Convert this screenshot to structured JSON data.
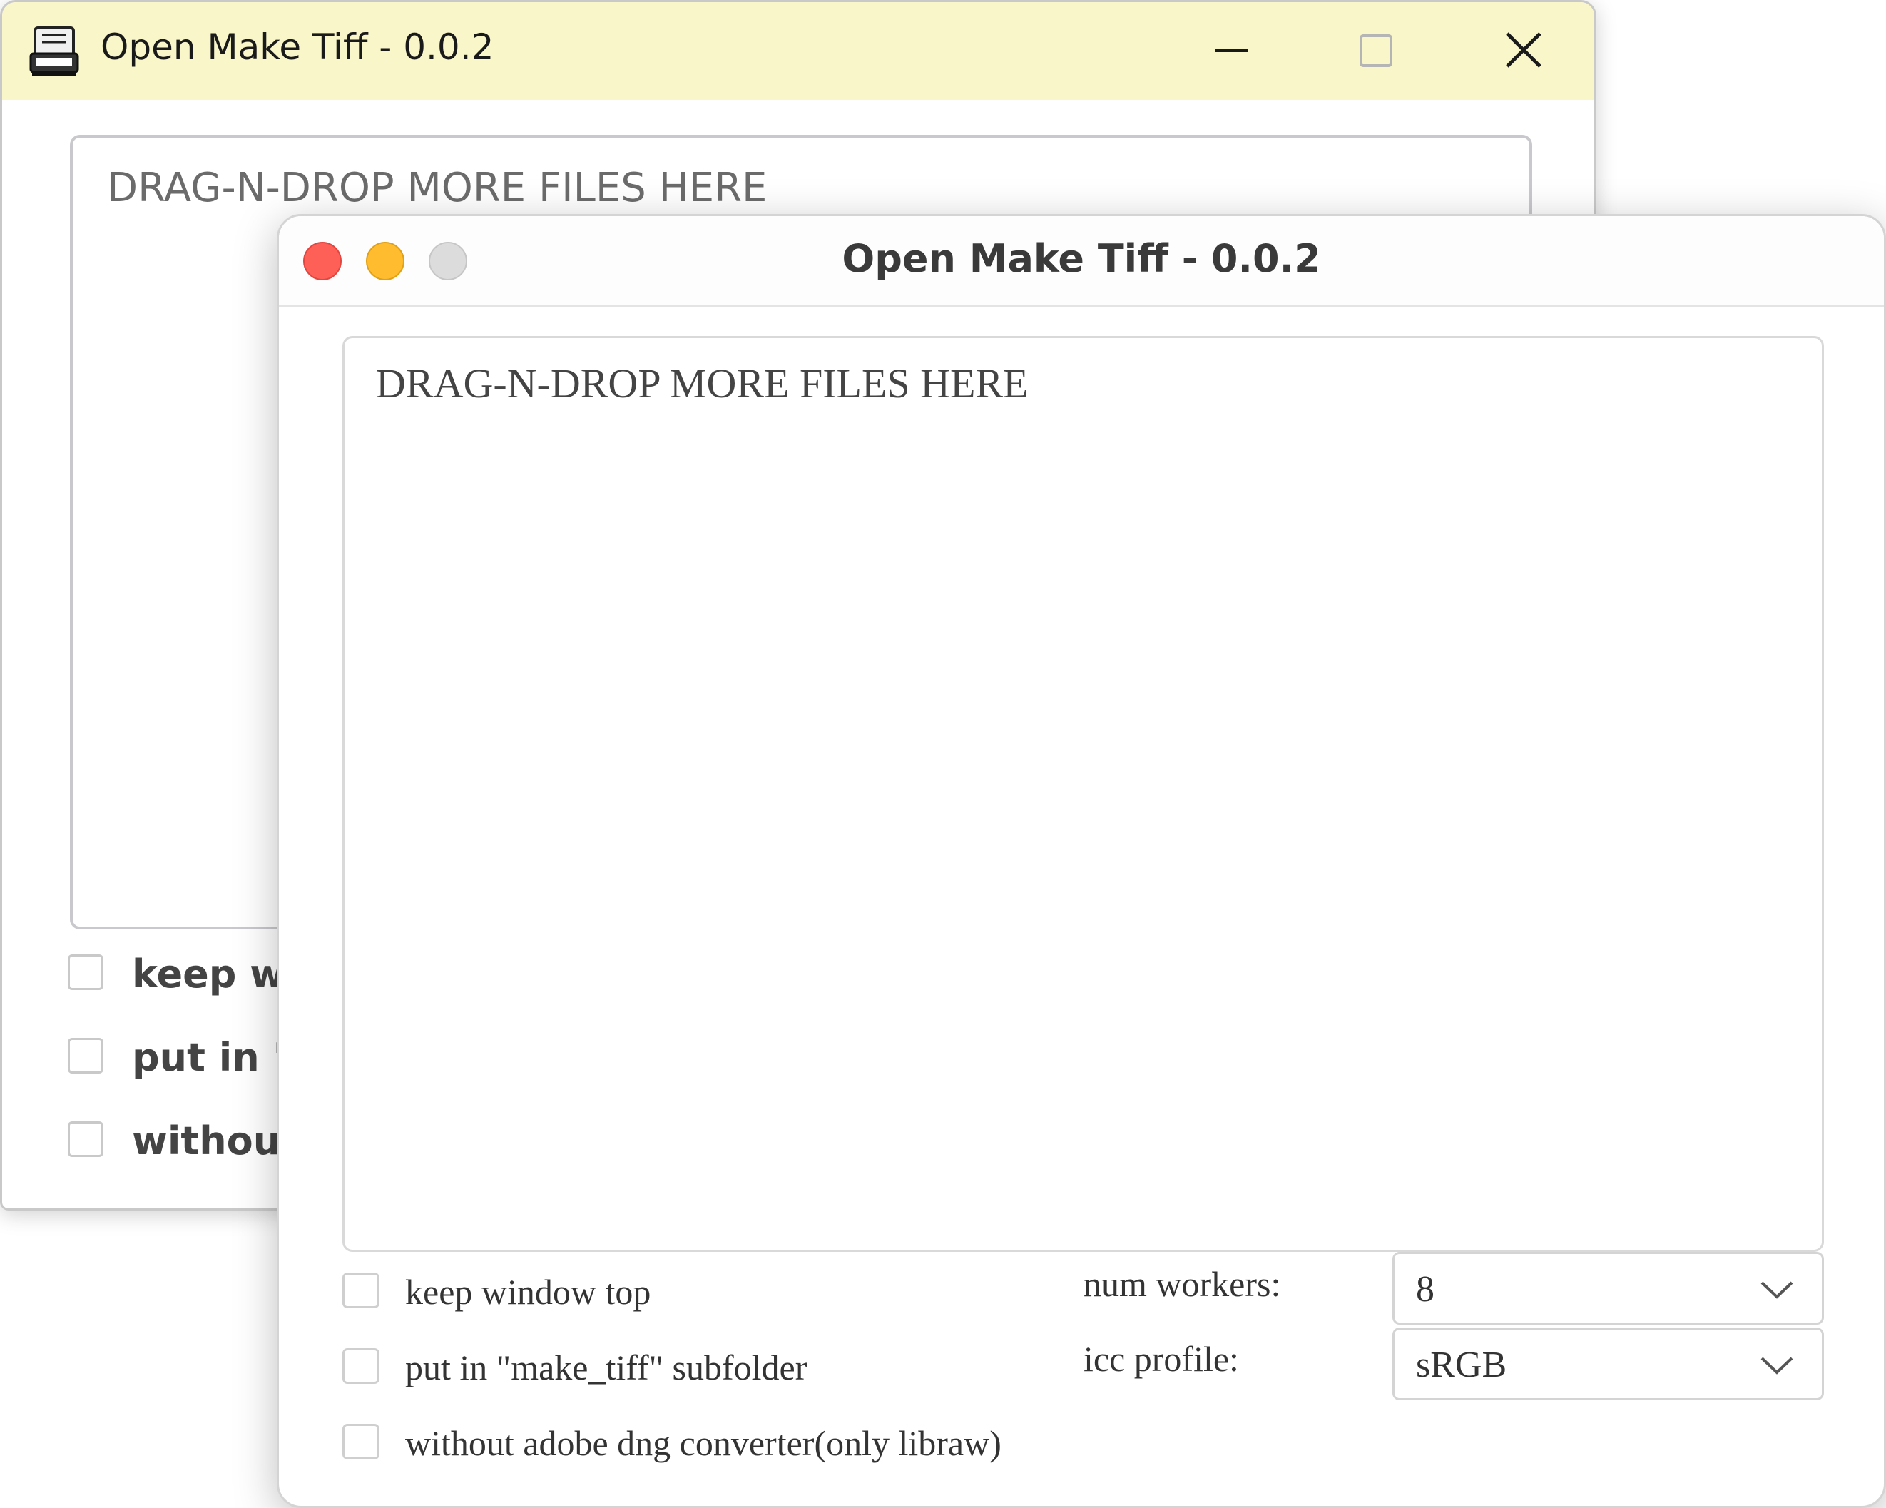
{
  "back_window": {
    "title": "Open Make Tiff - 0.0.2",
    "drop_zone_text": "DRAG-N-DROP MORE FILES HERE",
    "checkboxes": [
      {
        "label": "keep wi",
        "checked": false
      },
      {
        "label": "put in \"r",
        "checked": false
      },
      {
        "label": "without",
        "checked": false
      }
    ],
    "controls": {
      "minimize_icon": "minimize-icon",
      "maximize_icon": "maximize-icon",
      "close_icon": "close-icon"
    },
    "titlebar_color": "#f9f7c9"
  },
  "front_window": {
    "title": "Open Make Tiff - 0.0.2",
    "drop_zone_text": "DRAG-N-DROP MORE FILES HERE",
    "traffic_lights": {
      "close_color": "#fe5f57",
      "minimize_color": "#febc2e",
      "zoom_color": "#dcdcdc"
    },
    "checkboxes": [
      {
        "label": "keep window top",
        "checked": false
      },
      {
        "label": "put in \"make_tiff\" subfolder",
        "checked": false
      },
      {
        "label": "without adobe dng converter(only libraw)",
        "checked": false
      }
    ],
    "num_workers": {
      "label": "num workers:",
      "value": "8"
    },
    "icc_profile": {
      "label": "icc profile:",
      "value": "sRGB"
    }
  }
}
